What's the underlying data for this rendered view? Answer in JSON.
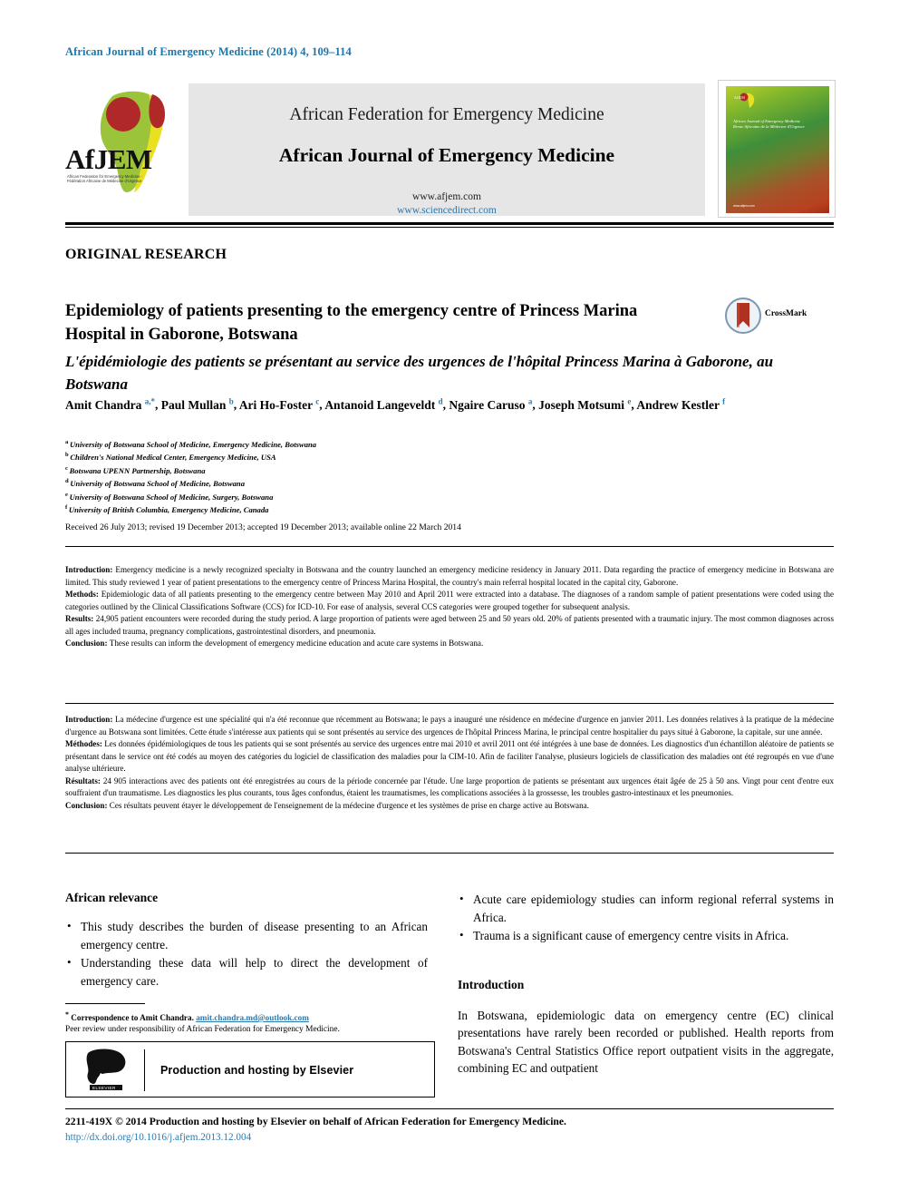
{
  "running_head": "African Journal of Emergency Medicine (2014) 4, 109–114",
  "masthead": {
    "logo_text": "AfJEM",
    "logo_subtext": "African Federation for Emergency Medicine · Fédération Africaine de Médecine d'Urgence",
    "federation_title": "African Federation for Emergency Medicine",
    "journal_title": "African Journal of Emergency Medicine",
    "url_journal": "www.afjem.com",
    "url_sciencedirect": "www.sciencedirect.com",
    "cover": {
      "logo_text": "AfJEM",
      "title_line1": "African Journal of Emergency Medicine",
      "title_line2": "Revue Africaine de la Médecine d'Urgence",
      "footer_url": "www.afjem.com"
    }
  },
  "article": {
    "kicker": "ORIGINAL RESEARCH",
    "title_en": "Epidemiology of patients presenting to the emergency centre of Princess Marina Hospital in Gaborone, Botswana",
    "title_fr": "L'épidémiologie des patients se présentant au service des urgences de l'hôpital Princess Marina à Gaborone, au Botswana",
    "crossmark_label": "CrossMark",
    "authors": [
      {
        "name": "Amit Chandra",
        "sup": "a,*"
      },
      {
        "name": "Paul Mullan",
        "sup": "b"
      },
      {
        "name": "Ari Ho-Foster",
        "sup": "c"
      },
      {
        "name": "Antanoid Langeveldt",
        "sup": "d"
      },
      {
        "name": "Ngaire Caruso",
        "sup": "a"
      },
      {
        "name": "Joseph Motsumi",
        "sup": "e"
      },
      {
        "name": "Andrew Kestler",
        "sup": "f"
      }
    ],
    "affiliations": [
      {
        "mark": "a",
        "text": "University of Botswana School of Medicine, Emergency Medicine, Botswana"
      },
      {
        "mark": "b",
        "text": "Children's National Medical Center, Emergency Medicine, USA"
      },
      {
        "mark": "c",
        "text": "Botswana UPENN Partnership, Botswana"
      },
      {
        "mark": "d",
        "text": "University of Botswana School of Medicine, Botswana"
      },
      {
        "mark": "e",
        "text": "University of Botswana School of Medicine, Surgery, Botswana"
      },
      {
        "mark": "f",
        "text": "University of British Columbia, Emergency Medicine, Canada"
      }
    ],
    "history": "Received 26 July 2013; revised 19 December 2013; accepted 19 December 2013; available online 22 March 2014"
  },
  "abstract_en": {
    "introduction_label": "Introduction:",
    "introduction_text": "Emergency medicine is a newly recognized specialty in Botswana and the country launched an emergency medicine residency in January 2011. Data regarding the practice of emergency medicine in Botswana are limited. This study reviewed 1 year of patient presentations to the emergency centre of Princess Marina Hospital, the country's main referral hospital located in the capital city, Gaborone.",
    "methods_label": "Methods:",
    "methods_text": "Epidemiologic data of all patients presenting to the emergency centre between May 2010 and April 2011 were extracted into a database. The diagnoses of a random sample of patient presentations were coded using the categories outlined by the Clinical Classifications Software (CCS) for ICD-10. For ease of analysis, several CCS categories were grouped together for subsequent analysis.",
    "results_label": "Results:",
    "results_text": "24,905 patient encounters were recorded during the study period. A large proportion of patients were aged between 25 and 50 years old. 20% of patients presented with a traumatic injury. The most common diagnoses across all ages included trauma, pregnancy complications, gastrointestinal disorders, and pneumonia.",
    "conclusion_label": "Conclusion:",
    "conclusion_text": "These results can inform the development of emergency medicine education and acute care systems in Botswana."
  },
  "abstract_fr": {
    "introduction_label": "Introduction:",
    "introduction_text": "La médecine d'urgence est une spécialité qui n'a été reconnue que récemment au Botswana; le pays a inauguré une résidence en médecine d'urgence en janvier 2011. Les données relatives à la pratique de la médecine d'urgence au Botswana sont limitées. Cette étude s'intéresse aux patients qui se sont présentés au service des urgences de l'hôpital Princess Marina, le principal centre hospitalier du pays situé à Gaborone, la capitale, sur une année.",
    "methods_label": "Méthodes:",
    "methods_text": "Les données épidémiologiques de tous les patients qui se sont présentés au service des urgences entre mai 2010 et avril 2011 ont été intégrées à une base de données. Les diagnostics d'un échantillon aléatoire de patients se présentant dans le service ont été codés au moyen des catégories du logiciel de classification des maladies pour la CIM-10. Afin de faciliter l'analyse, plusieurs logiciels de classification des maladies ont été regroupés en vue d'une analyse ultérieure.",
    "results_label": "Résultats:",
    "results_text": "24 905 interactions avec des patients ont été enregistrées au cours de la période concernée par l'étude. Une large proportion de patients se présentant aux urgences était âgée de 25 à 50 ans. Vingt pour cent d'entre eux souffraient d'un traumatisme. Les diagnostics les plus courants, tous âges confondus, étaient les traumatismes, les complications associées à la grossesse, les troubles gastro-intestinaux et les pneumonies.",
    "conclusion_label": "Conclusion:",
    "conclusion_text": "Ces résultats peuvent étayer le développement de l'enseignement de la médecine d'urgence et les systèmes de prise en charge active au Botswana."
  },
  "african_relevance": {
    "heading": "African relevance",
    "bullets_left": [
      "This study describes the burden of disease presenting to an African emergency centre.",
      "Understanding these data will help to direct the development of emergency care."
    ],
    "bullets_right": [
      "Acute care epidemiology studies can inform regional referral systems in Africa.",
      "Trauma is a significant cause of emergency centre visits in Africa."
    ]
  },
  "introduction": {
    "heading": "Introduction",
    "body": "In Botswana, epidemiologic data on emergency centre (EC) clinical presentations have rarely been recorded or published. Health reports from Botswana's Central Statistics Office report outpatient visits in the aggregate, combining EC and outpatient"
  },
  "footnotes": {
    "correspondence_label": "Correspondence to Amit Chandra.",
    "correspondence_email": "amit.chandra.md@outlook.com",
    "peer_review": "Peer review under responsibility of African Federation for Emergency Medicine.",
    "elsevier_banner": "Production and hosting by Elsevier",
    "elsevier_wordmark": "ELSEVIER"
  },
  "footer": {
    "copyright": "2211-419X © 2014 Production and hosting by Elsevier on behalf of African Federation for Emergency Medicine.",
    "doi": "http://dx.doi.org/10.1016/j.afjem.2013.12.004"
  },
  "colors": {
    "link": "#2a7ab0",
    "running_head": "#1f76a8",
    "masthead_bg": "#e6e6e6"
  }
}
